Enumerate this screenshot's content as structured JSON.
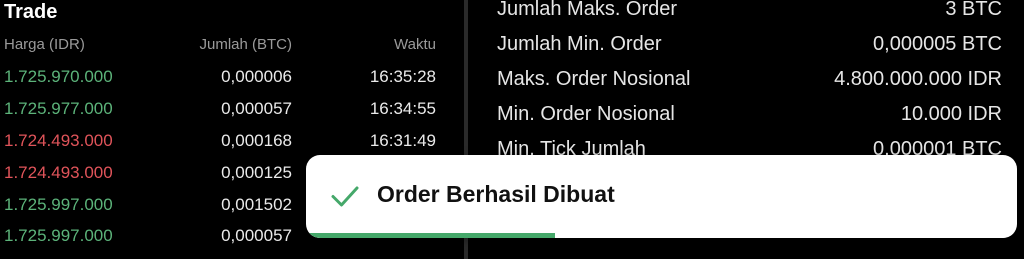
{
  "trade": {
    "title": "Trade",
    "headers": {
      "price": "Harga (IDR)",
      "amount": "Jumlah (BTC)",
      "time": "Waktu"
    },
    "rows": [
      {
        "price": "1.725.970.000",
        "side": "buy",
        "amount": "0,000006",
        "time": "16:35:28"
      },
      {
        "price": "1.725.977.000",
        "side": "buy",
        "amount": "0,000057",
        "time": "16:34:55"
      },
      {
        "price": "1.724.493.000",
        "side": "sell",
        "amount": "0,000168",
        "time": "16:31:49"
      },
      {
        "price": "1.724.493.000",
        "side": "sell",
        "amount": "0,000125",
        "time": ""
      },
      {
        "price": "1.725.997.000",
        "side": "buy",
        "amount": "0,001502",
        "time": ""
      },
      {
        "price": "1.725.997.000",
        "side": "buy",
        "amount": "0,000057",
        "time": ""
      }
    ]
  },
  "info": {
    "rows": [
      {
        "label": "Jumlah Maks. Order",
        "value": "3 BTC"
      },
      {
        "label": "Jumlah Min. Order",
        "value": "0,000005 BTC"
      },
      {
        "label": "Maks. Order Nosional",
        "value": "4.800.000.000 IDR"
      },
      {
        "label": "Min. Order Nosional",
        "value": "10.000 IDR"
      },
      {
        "label": "Min. Tick Jumlah",
        "value": "0,000001 BTC"
      }
    ]
  },
  "toast": {
    "message": "Order Berhasil Dibuat",
    "icon": "check-icon",
    "progress": 0.35
  },
  "colors": {
    "buy": "#5cb37a",
    "sell": "#e0545a",
    "success": "#45a86a"
  }
}
